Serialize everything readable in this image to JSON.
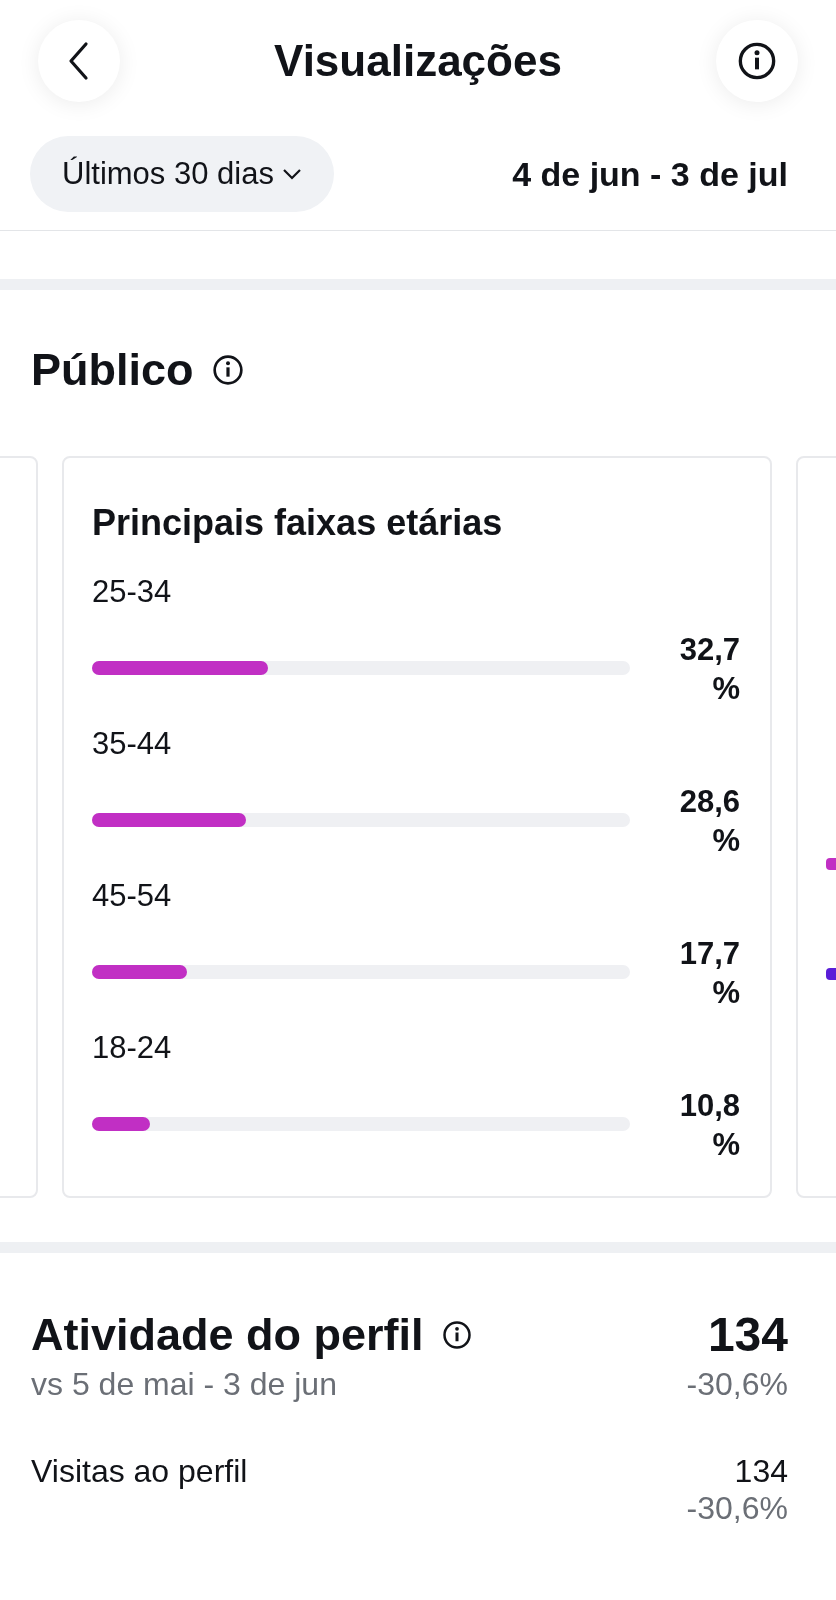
{
  "header": {
    "title": "Visualizações"
  },
  "period": {
    "dropdown": "Últimos 30 dias",
    "range": "4 de jun - 3 de jul"
  },
  "audience": {
    "title": "Público",
    "age_card": {
      "title": "Principais faixas etárias",
      "rows": [
        {
          "label": "25-34",
          "level": 0.327,
          "value": "32,7 %"
        },
        {
          "label": "35-44",
          "level": 0.286,
          "value": "28,6 %"
        },
        {
          "label": "45-54",
          "level": 0.177,
          "value": "17,7 %"
        },
        {
          "label": "18-24",
          "level": 0.108,
          "value": "10,8 %"
        }
      ]
    },
    "next_card": {
      "legend": [
        {
          "color": "#c12fc4"
        },
        {
          "color": "#5a1ed8"
        }
      ]
    }
  },
  "activity": {
    "title": "Atividade do perfil",
    "total": "134",
    "comparison": "vs 5 de mai - 3 de jun",
    "change": "-30,6%",
    "rows": [
      {
        "label": "Visitas ao perfil",
        "value": "134",
        "change": "-30,6%"
      }
    ]
  }
}
